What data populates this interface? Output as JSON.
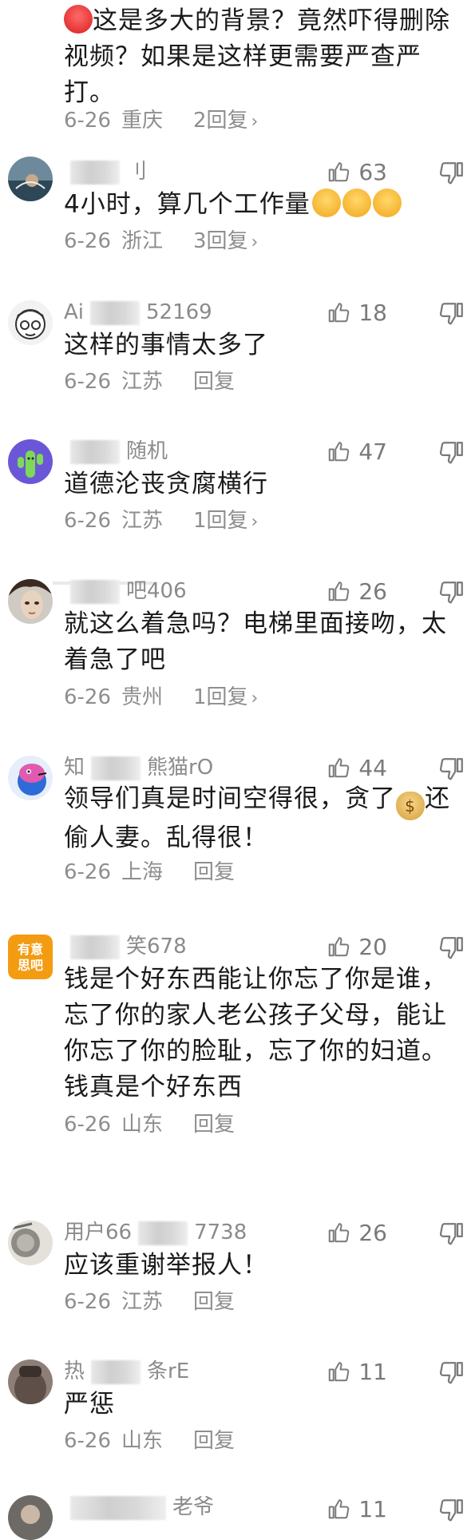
{
  "comments": [
    {
      "body": "这是多大的背景？竟然吓得删除视频？如果是这样更需要严查严打。",
      "date": "6-26",
      "location": "重庆",
      "reply": "2回复"
    },
    {
      "name": "刂",
      "body": "4小时，算几个工作量",
      "date": "6-26",
      "location": "浙江",
      "reply": "3回复",
      "likes": "63"
    },
    {
      "name_prefix": "Ai",
      "name": "52169",
      "body": "这样的事情太多了",
      "date": "6-26",
      "location": "江苏",
      "reply": "回复",
      "likes": "18"
    },
    {
      "name": "随机",
      "body": "道德沦丧贪腐横行",
      "date": "6-26",
      "location": "江苏",
      "reply": "1回复",
      "likes": "47"
    },
    {
      "name": "吧406",
      "body": "就这么着急吗？电梯里面接吻，太着急了吧",
      "date": "6-26",
      "location": "贵州",
      "reply": "1回复",
      "likes": "26"
    },
    {
      "name_prefix": "知",
      "name": "熊猫rO",
      "body_before": "领导们真是时间空得很，贪了",
      "body_after": "还偷人妻。乱得很！",
      "date": "6-26",
      "location": "上海",
      "reply": "回复",
      "likes": "44"
    },
    {
      "name": "笑678",
      "body": "钱是个好东西能让你忘了你是谁，忘了你的家人老公孩子父母，能让你忘了你的脸耻，忘了你的妇道。钱真是个好东西",
      "date": "6-26",
      "location": "山东",
      "reply": "回复",
      "likes": "20",
      "avatar_text_1": "有意",
      "avatar_text_2": "思吧"
    },
    {
      "name_prefix": "用户66",
      "name": "7738",
      "body": "应该重谢举报人！",
      "date": "6-26",
      "location": "江苏",
      "reply": "回复",
      "likes": "26"
    },
    {
      "name_prefix": "热",
      "name": "条rE",
      "body": "严惩",
      "date": "6-26",
      "location": "山东",
      "reply": "回复",
      "likes": "11"
    },
    {
      "name": "老爷",
      "likes": "11"
    }
  ]
}
